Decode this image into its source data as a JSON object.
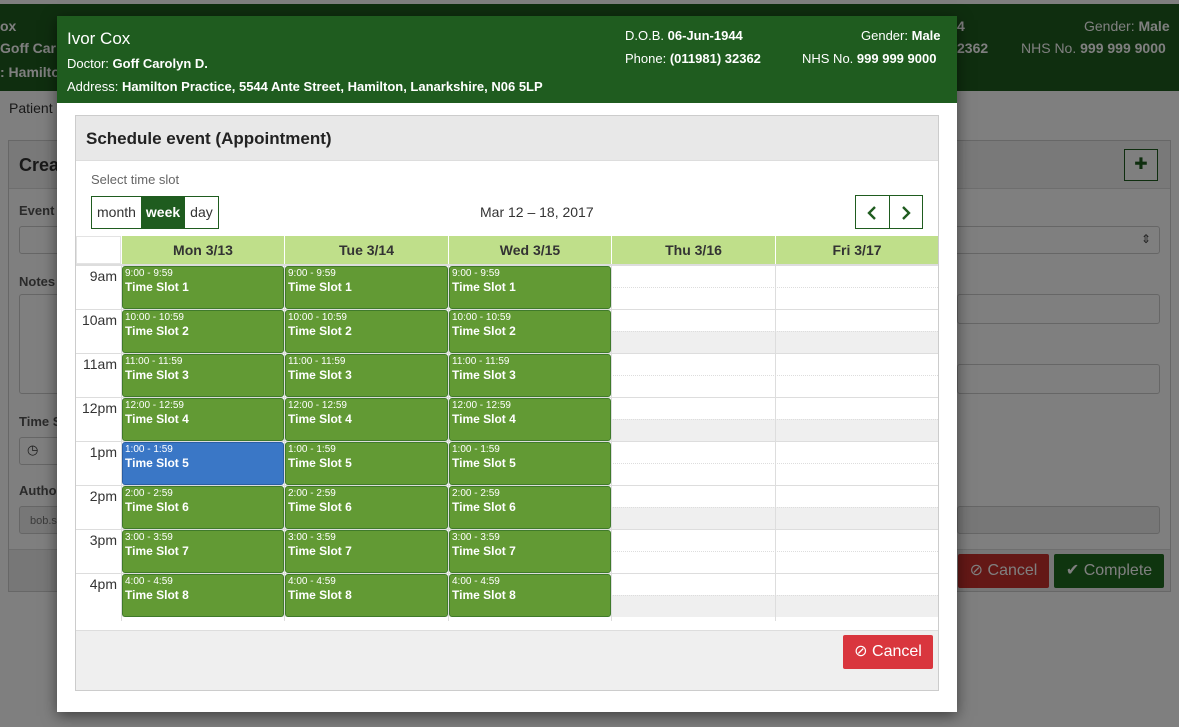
{
  "background": {
    "banner": {
      "name_partial": "ox",
      "doctor_partial": "Goff Car",
      "address_partial": ": Hamilto",
      "dob_partial": "4",
      "phone_partial": "2362",
      "gender_label": "Gender:",
      "gender_value": "Male",
      "nhs_label": "NHS No.",
      "nhs_value": "999 999 9000"
    },
    "breadcrumb": "Patient",
    "panel_title": "Crea",
    "event_label": "Event",
    "notes_label": "Notes",
    "time_label": "Time S",
    "author_label": "Autho",
    "author_value": "bob.s",
    "cancel_label": "Cancel",
    "complete_label": "Complete",
    "colors": {
      "banner": "#1f5c1f",
      "cancel": "#c9302c",
      "complete": "#1f6b1f"
    }
  },
  "patient": {
    "name": "Ivor Cox",
    "doctor_label": "Doctor:",
    "doctor": "Goff Carolyn D.",
    "address_label": "Address:",
    "address": "Hamilton Practice, 5544 Ante Street, Hamilton, Lanarkshire, N06 5LP",
    "dob_label": "D.O.B.",
    "dob": "06-Jun-1944",
    "phone_label": "Phone:",
    "phone": "(011981) 32362",
    "gender_label": "Gender:",
    "gender": "Male",
    "nhs_label": "NHS No.",
    "nhs": "999 999 9000"
  },
  "schedule": {
    "title": "Schedule event (Appointment)",
    "select_label": "Select time slot",
    "views": [
      "month",
      "week",
      "day"
    ],
    "active_view": "week",
    "date_range": "Mar 12 – 18, 2017",
    "prev_icon": "chevron-left-icon",
    "next_icon": "chevron-right-icon",
    "days": [
      "Mon 3/13",
      "Tue 3/14",
      "Wed 3/15",
      "Thu 3/16",
      "Fri 3/17"
    ],
    "hours": [
      "9am",
      "10am",
      "11am",
      "12pm",
      "1pm",
      "2pm",
      "3pm",
      "4pm"
    ],
    "slots": [
      {
        "time": "9:00 - 9:59",
        "title": "Time Slot 1"
      },
      {
        "time": "10:00 - 10:59",
        "title": "Time Slot 2"
      },
      {
        "time": "11:00 - 11:59",
        "title": "Time Slot 3"
      },
      {
        "time": "12:00 - 12:59",
        "title": "Time Slot 4"
      },
      {
        "time": "1:00 - 1:59",
        "title": "Time Slot 5"
      },
      {
        "time": "2:00 - 2:59",
        "title": "Time Slot 6"
      },
      {
        "time": "3:00 - 3:59",
        "title": "Time Slot 7"
      },
      {
        "time": "4:00 - 4:59",
        "title": "Time Slot 8"
      }
    ],
    "slot_days": [
      "Mon 3/13",
      "Tue 3/14",
      "Wed 3/15"
    ],
    "selected": {
      "day": "Mon 3/13",
      "slot": "Time Slot 5"
    },
    "cancel_label": "Cancel",
    "colors": {
      "header": "#1f5c1f",
      "day_header": "#bfdf8a",
      "slot": "#629a34",
      "slot_selected": "#3a77c6",
      "cancel": "#d9363e"
    }
  }
}
